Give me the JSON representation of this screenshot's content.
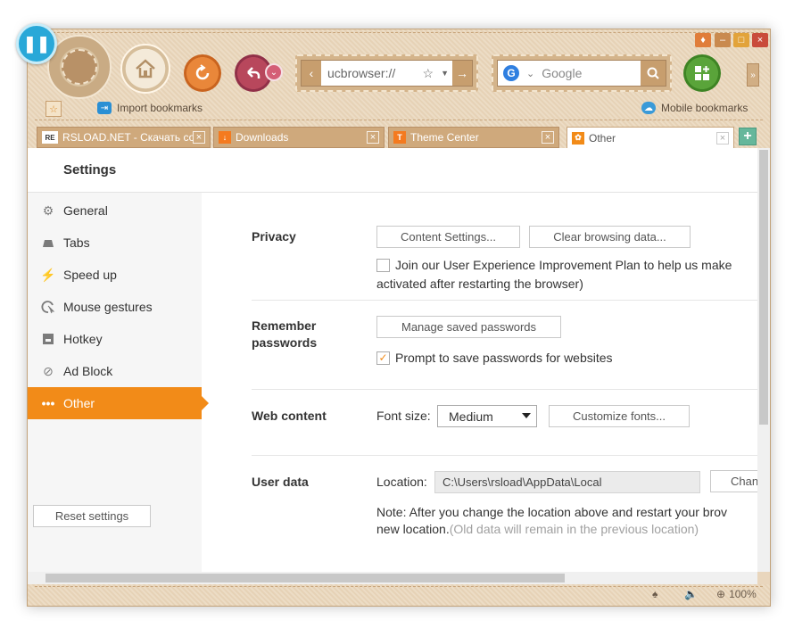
{
  "toolbar": {
    "address": "ucbrowser://",
    "search_engine": "G",
    "search_placeholder": "Google",
    "more": "»",
    "apps_symbol": "+"
  },
  "bookmarks": {
    "import": "Import bookmarks",
    "mobile": "Mobile bookmarks"
  },
  "tabs": [
    {
      "label": "RSLOAD.NET - Скачать со",
      "icon": "RE",
      "color": "#ffffff"
    },
    {
      "label": "Downloads",
      "icon": "↓",
      "color": "#f47a1f"
    },
    {
      "label": "Theme Center",
      "icon": "T",
      "color": "#f47a1f"
    },
    {
      "label": "Other",
      "icon": "✿",
      "color": "#f28b18"
    }
  ],
  "settings": {
    "title": "Settings",
    "sidebar": [
      {
        "label": "General",
        "icon": "gear-icon"
      },
      {
        "label": "Tabs",
        "icon": "tab-icon"
      },
      {
        "label": "Speed up",
        "icon": "bolt-icon"
      },
      {
        "label": "Mouse gestures",
        "icon": "cursor-icon"
      },
      {
        "label": "Hotkey",
        "icon": "keyboard-icon"
      },
      {
        "label": "Ad Block",
        "icon": "block-icon"
      },
      {
        "label": "Other",
        "icon": "dots-icon"
      }
    ],
    "reset": "Reset settings"
  },
  "privacy": {
    "title": "Privacy",
    "content_settings": "Content Settings...",
    "clear_data": "Clear browsing data...",
    "join_plan": "Join our User Experience Improvement Plan to help us make",
    "join_plan_note": "activated after restarting the browser)"
  },
  "passwords": {
    "title_line1": "Remember",
    "title_line2": "passwords",
    "manage": "Manage saved passwords",
    "prompt": "Prompt to save passwords for websites"
  },
  "web_content": {
    "title": "Web content",
    "font_size_label": "Font size:",
    "font_size_value": "Medium",
    "customize": "Customize fonts..."
  },
  "user_data": {
    "title": "User data",
    "location_label": "Location:",
    "location_value": "C:\\Users\\rsload\\AppData\\Local",
    "change": "Chan",
    "note_line1": "Note: After you change the location above and restart your brov",
    "note_line2_a": "new location.",
    "note_line2_b": "(Old data will remain in the previous location)"
  },
  "status": {
    "zoom": "100%"
  }
}
